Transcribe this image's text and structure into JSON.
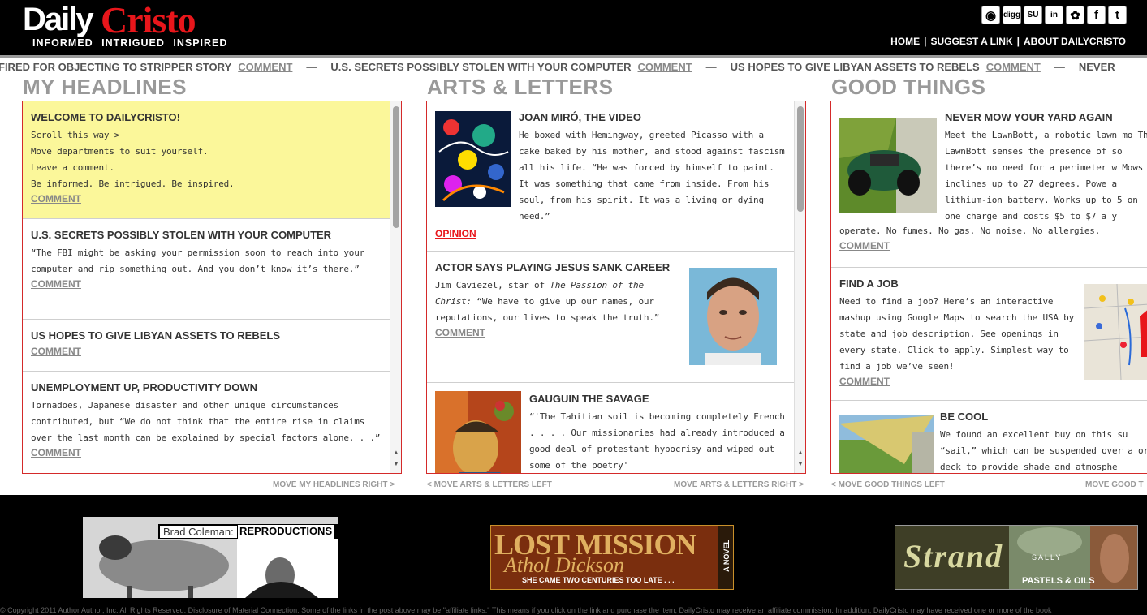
{
  "header": {
    "logo_daily": "Daily",
    "logo_cristo": "Cristo",
    "tagline": "INFORMED INTRIGUED INSPIRED",
    "social": [
      {
        "name": "rss-icon",
        "glyph": "◉"
      },
      {
        "name": "digg-icon",
        "glyph": "digg"
      },
      {
        "name": "stumbleupon-icon",
        "glyph": "SU"
      },
      {
        "name": "linkedin-icon",
        "glyph": "in"
      },
      {
        "name": "delicious-icon",
        "glyph": "✿"
      },
      {
        "name": "facebook-icon",
        "glyph": "f"
      },
      {
        "name": "twitter-icon",
        "glyph": "t"
      }
    ],
    "nav": [
      "HOME",
      "SUGGEST A LINK",
      "ABOUT DAILYCRISTO"
    ]
  },
  "ticker": {
    "items": [
      "N FIRED FOR OBJECTING TO STRIPPER STORY",
      "U.S. SECRETS POSSIBLY STOLEN WITH YOUR COMPUTER",
      "US HOPES TO GIVE LIBYAN ASSETS TO REBELS",
      "NEVER"
    ],
    "comment": "COMMENT",
    "dash": "—"
  },
  "columns": {
    "headlines": {
      "title": "MY HEADLINES",
      "items": [
        {
          "title": "WELCOME TO DAILYCRISTO!",
          "lines": [
            "Scroll this way >",
            "Move departments to suit yourself.",
            "Leave a comment.",
            "Be informed. Be intrigued. Be inspired."
          ],
          "comment": "COMMENT"
        },
        {
          "title": "U.S. SECRETS POSSIBLY STOLEN WITH YOUR COMPUTER",
          "text": "“The FBI might be asking your permission soon to reach into your computer and rip something out. And you don’t know it’s there.”",
          "comment": "COMMENT"
        },
        {
          "title": "US HOPES TO GIVE LIBYAN ASSETS TO REBELS",
          "comment": "COMMENT"
        },
        {
          "title": "UNEMPLOYMENT UP, PRODUCTIVITY DOWN",
          "text": "Tornadoes, Japanese disaster and other unique circumstances contributed, but “We do not think that the entire rise in claims over the last month can be explained by special factors alone. . .”",
          "comment": "COMMENT"
        }
      ],
      "move_right": "MOVE MY HEADLINES RIGHT >"
    },
    "arts": {
      "title": "ARTS & LETTERS",
      "items": [
        {
          "title": "JOAN MIRÓ, THE VIDEO",
          "text": "He boxed with Hemingway, greeted Picasso with a cake baked by his mother, and stood against fascism all his life. “He was forced by himself to paint. It was something that came from inside. From his soul, from his spirit. It was a living or dying need.”",
          "tag": "OPINION"
        },
        {
          "title": "ACTOR SAYS PLAYING JESUS SANK CAREER",
          "text_a": "Jim Caviezel, star of ",
          "text_em": "The Passion of the Christ:",
          "text_b": " “We have to give up our names, our reputations, our lives to speak the truth.”",
          "comment": "COMMENT"
        },
        {
          "title": "GAUGUIN THE SAVAGE",
          "text": "“'The Tahitian soil is becoming completely French . . . . Our missionaries had already introduced a good deal of protestant hypocrisy and wiped out some of the poetry'"
        }
      ],
      "move_left": "< MOVE ARTS & LETTERS LEFT",
      "move_right": "MOVE ARTS & LETTERS RIGHT >"
    },
    "good": {
      "title": "GOOD THINGS",
      "items": [
        {
          "title": "NEVER MOW YOUR YARD AGAIN",
          "text_side": "Meet the LawnBott, a robotic lawn mo The LawnBott senses the presence of so there’s no need for a perimeter w Mows inclines up to 27 degrees. Powe a lithium-ion battery. Works up to 5 on one charge and costs $5 to $7 a y",
          "text_full": "operate. No fumes. No gas. No noise. No allergies.",
          "comment": "COMMENT"
        },
        {
          "title": "FIND A JOB",
          "text": "Need to find a job? Here’s an interactive mashup using Google Maps to search the USA by state and job description. See openings in every state. Click to apply. Simplest way to find a job we’ve seen!",
          "comment": "COMMENT"
        },
        {
          "title": "BE COOL",
          "text": "We found an excellent buy on this su “sail,” which can be suspended over a or deck to provide shade and atmosphe"
        }
      ],
      "move_left": "< MOVE GOOD THINGS LEFT",
      "move_right": "MOVE GOOD T"
    }
  },
  "ads": {
    "brad_name": "Brad Coleman:",
    "brad_repro": "REPRODUCTIONS",
    "lost_mission": "LOST MISSION",
    "athol": "Athol Dickson",
    "came": "SHE CAME TWO CENTURIES TOO LATE . . .",
    "novel": "A NOVEL",
    "sally": "SALLY",
    "strand": "Strand",
    "pastels": "PASTELS & OILS"
  },
  "copyright": "© Copyright 2011 Author Author, Inc. All Rights Reserved. Disclosure of Material Connection: Some of the links in the post above may be \"affiliate links.\" This means if you click on the link and purchase the item, DailyCristo may receive an affiliate commission. In addition, DailyCristo may have received one or more of the book"
}
